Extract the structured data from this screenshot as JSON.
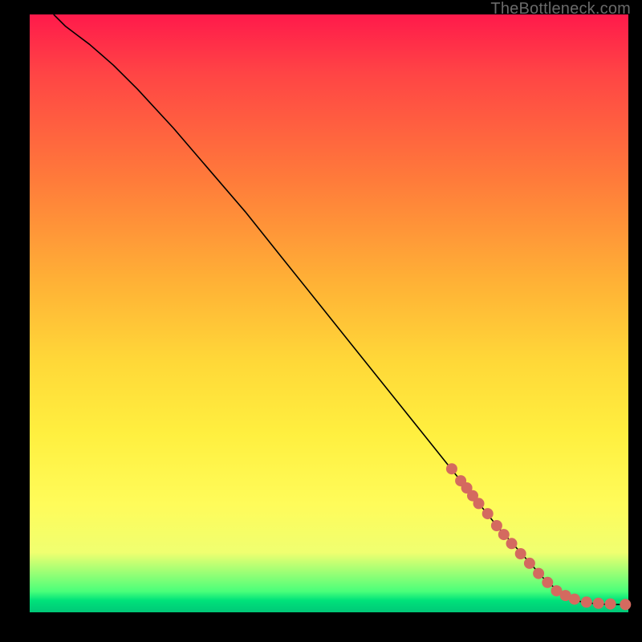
{
  "watermark": "TheBottleneck.com",
  "chart_data": {
    "type": "line",
    "title": "",
    "xlabel": "",
    "ylabel": "",
    "xlim": [
      0,
      100
    ],
    "ylim": [
      0,
      100
    ],
    "note": "Axes are unlabeled in the source image. x/y are expressed as 0–100 percent of the plotting rectangle.",
    "series": [
      {
        "name": "curve",
        "color": "#000000",
        "x": [
          4,
          6,
          8,
          10,
          14,
          18,
          24,
          30,
          36,
          42,
          48,
          54,
          60,
          66,
          72,
          78,
          82,
          86,
          89,
          91,
          93,
          95,
          97,
          100
        ],
        "y": [
          100,
          98,
          96.5,
          95,
          91.5,
          87.5,
          81,
          74,
          67,
          59.5,
          52,
          44.5,
          37,
          29.5,
          22,
          14.5,
          10,
          5.5,
          3,
          2,
          1.6,
          1.4,
          1.3,
          1.3
        ]
      },
      {
        "name": "dots",
        "color": "#d46a5f",
        "type": "scatter",
        "x": [
          70.5,
          72,
          73,
          74,
          75,
          76.5,
          78,
          79.2,
          80.5,
          82,
          83.5,
          85,
          86.5,
          88,
          89.5,
          91,
          93,
          95,
          97,
          99.5
        ],
        "y": [
          24,
          22,
          20.8,
          19.5,
          18.2,
          16.5,
          14.5,
          13,
          11.5,
          9.8,
          8.2,
          6.5,
          5,
          3.6,
          2.8,
          2.2,
          1.7,
          1.5,
          1.4,
          1.3
        ]
      }
    ]
  }
}
